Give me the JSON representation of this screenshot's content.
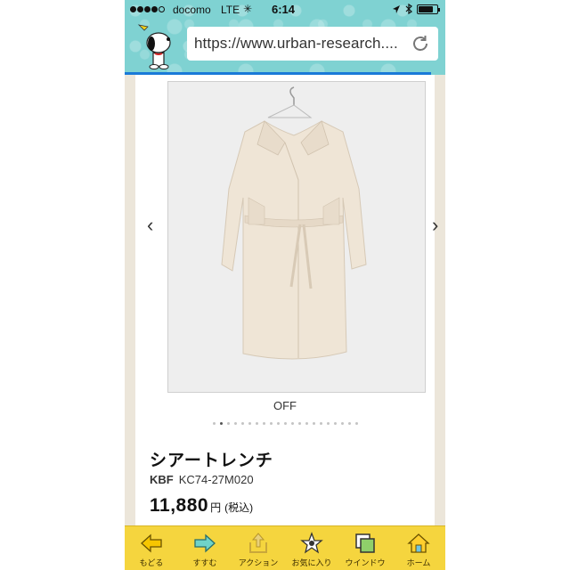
{
  "status_bar": {
    "carrier": "docomo",
    "network": "LTE",
    "spinner": "✳",
    "time": "6:14",
    "icons": [
      "location-icon",
      "bluetooth-icon",
      "battery-icon"
    ]
  },
  "browser": {
    "url": "https://www.urban-research....",
    "colors": {
      "topbar": "#7fd2d2",
      "progress": "#1a7ad8"
    }
  },
  "product": {
    "carousel": {
      "prev": "‹",
      "next": "›",
      "current_index": 1,
      "total": 21
    },
    "color_label": "OFF",
    "title": "シアートレンチ",
    "brand": "KBF",
    "code": "KC74-27M020",
    "price": "11,880",
    "currency": "円",
    "tax_note": "(税込)"
  },
  "toolbar": {
    "items": [
      {
        "label": "もどる",
        "icon": "back-arrow-icon"
      },
      {
        "label": "すすむ",
        "icon": "forward-arrow-icon"
      },
      {
        "label": "アクション",
        "icon": "share-icon"
      },
      {
        "label": "お気に入り",
        "icon": "favorite-icon"
      },
      {
        "label": "ウインドウ",
        "icon": "windows-icon"
      },
      {
        "label": "ホーム",
        "icon": "home-icon"
      }
    ],
    "colors": {
      "background": "#f5d53e"
    }
  }
}
